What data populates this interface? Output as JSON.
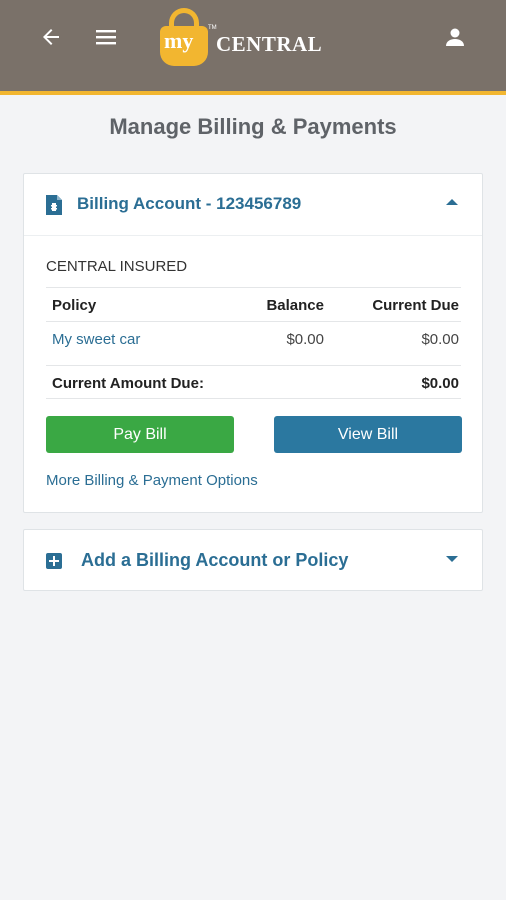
{
  "header": {
    "logo_my": "my",
    "logo_tm": "TM",
    "logo_central": "CENTRAL"
  },
  "page": {
    "title": "Manage Billing & Payments"
  },
  "billing_account": {
    "title": "Billing Account - 123456789",
    "insured_name": "CENTRAL INSURED",
    "columns": [
      "Policy",
      "Balance",
      "Current Due"
    ],
    "policies": [
      {
        "policy": "My sweet car",
        "balance": "$0.00",
        "current_due": "$0.00"
      }
    ],
    "total_label": "Current Amount Due:",
    "total_value": "$0.00",
    "pay_button": "Pay Bill",
    "view_button": "View Bill",
    "more_link": "More Billing & Payment Options"
  },
  "add_account": {
    "title": "Add a Billing Account or Policy"
  },
  "colors": {
    "header_bg": "#7a7169",
    "accent": "#f2b630",
    "link": "#2b6e94",
    "pay": "#3aa844",
    "view": "#2b78a0"
  },
  "icons": [
    "back-arrow-icon",
    "hamburger-menu-icon",
    "user-icon",
    "lock-logo-icon",
    "document-icon",
    "caret-up-icon",
    "plus-square-icon",
    "caret-down-icon"
  ]
}
